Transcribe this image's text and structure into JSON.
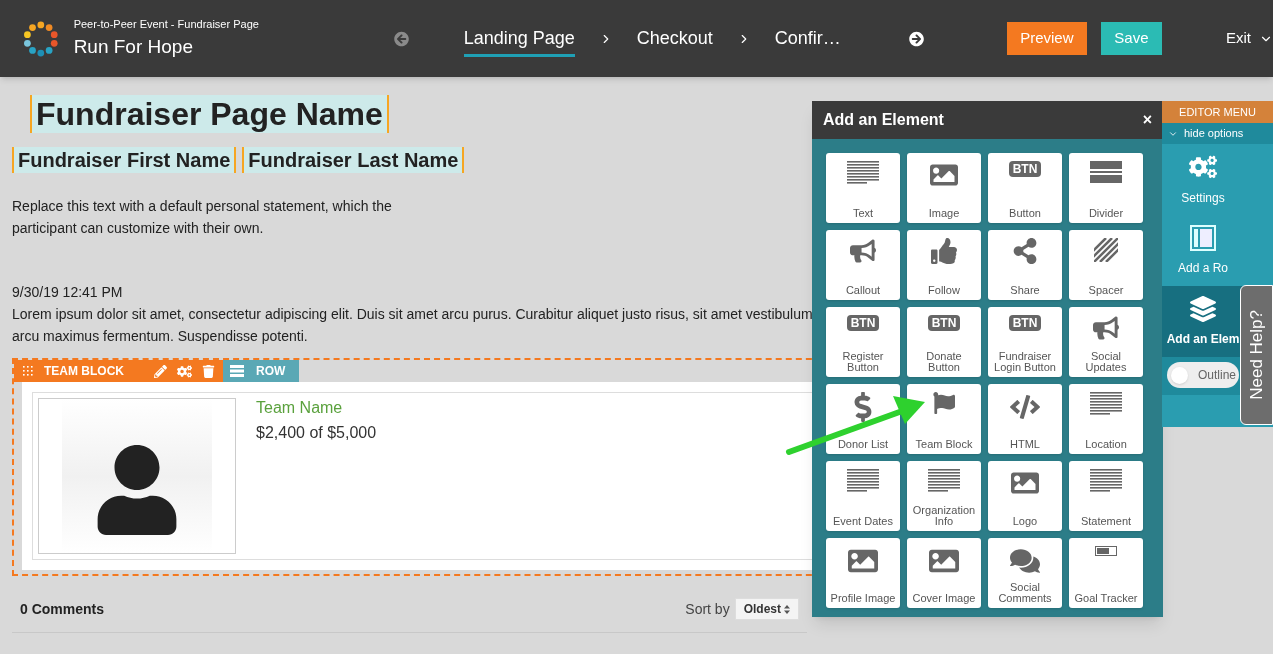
{
  "header": {
    "subtitle": "Peer-to-Peer Event - Fundraiser Page",
    "title": "Run For Hope",
    "steps": [
      {
        "label": "Landing Page",
        "selected": true
      },
      {
        "label": "Checkout",
        "selected": false
      },
      {
        "label": "Confir…",
        "selected": false
      }
    ],
    "preview": "Preview",
    "save": "Save",
    "exit": "Exit"
  },
  "page": {
    "name": "Fundraiser Page Name",
    "first_name": "Fundraiser First Name",
    "last_name": "Fundraiser Last Name",
    "statement": "Replace this text with a default personal statement, which the participant can customize with their own.",
    "date": "9/30/19 12:41 PM",
    "lorem": "Lorem ipsum dolor sit amet, consectetur adipiscing elit. Duis sit amet arcu purus. Curabitur aliquet justo risus, sit amet vestibulum arcu maximus fermentum. Suspendisse potenti.",
    "team_block": {
      "label": "TEAM BLOCK",
      "row": "ROW",
      "team_name": "Team Name",
      "progress": "$2,400 of $5,000"
    },
    "comments": "0 Comments",
    "sort_label": "Sort by",
    "sort_value": "Oldest"
  },
  "panel": {
    "title": "Add an Element",
    "close": "×",
    "tiles": [
      {
        "label": "Text",
        "kind": "lines"
      },
      {
        "label": "Image",
        "kind": "image"
      },
      {
        "label": "Button",
        "kind": "btn",
        "badge": "BTN"
      },
      {
        "label": "Divider",
        "kind": "divider"
      },
      {
        "label": "Callout",
        "kind": "bullhorn"
      },
      {
        "label": "Follow",
        "kind": "thumb"
      },
      {
        "label": "Share",
        "kind": "share"
      },
      {
        "label": "Spacer",
        "kind": "stripes"
      },
      {
        "label": "Register Button",
        "kind": "btn",
        "badge": "BTN"
      },
      {
        "label": "Donate Button",
        "kind": "btn",
        "badge": "BTN"
      },
      {
        "label": "Fundraiser Login Button",
        "kind": "btn",
        "badge": "BTN"
      },
      {
        "label": "Social Updates",
        "kind": "bullhorn"
      },
      {
        "label": "Donor List",
        "kind": "dollar"
      },
      {
        "label": "Team Block",
        "kind": "flag"
      },
      {
        "label": "HTML",
        "kind": "code"
      },
      {
        "label": "Location",
        "kind": "lines"
      },
      {
        "label": "Event Dates",
        "kind": "lines"
      },
      {
        "label": "Organization Info",
        "kind": "lines"
      },
      {
        "label": "Logo",
        "kind": "image"
      },
      {
        "label": "Statement",
        "kind": "lines"
      },
      {
        "label": "Profile Image",
        "kind": "photo"
      },
      {
        "label": "Cover Image",
        "kind": "photo"
      },
      {
        "label": "Social Comments",
        "kind": "comments"
      },
      {
        "label": "Goal Tracker",
        "kind": "goal"
      }
    ]
  },
  "editor_menu": {
    "title": "EDITOR MENU",
    "hide_options": "hide options",
    "items": [
      {
        "label": "Settings",
        "kind": "gears",
        "selected": false
      },
      {
        "label": "Add a Ro",
        "kind": "row",
        "selected": false
      },
      {
        "label": "Add an Elem",
        "kind": "layers",
        "selected": true
      }
    ],
    "outline": {
      "label": "Outline",
      "on": false
    }
  },
  "help": "Need Help?"
}
